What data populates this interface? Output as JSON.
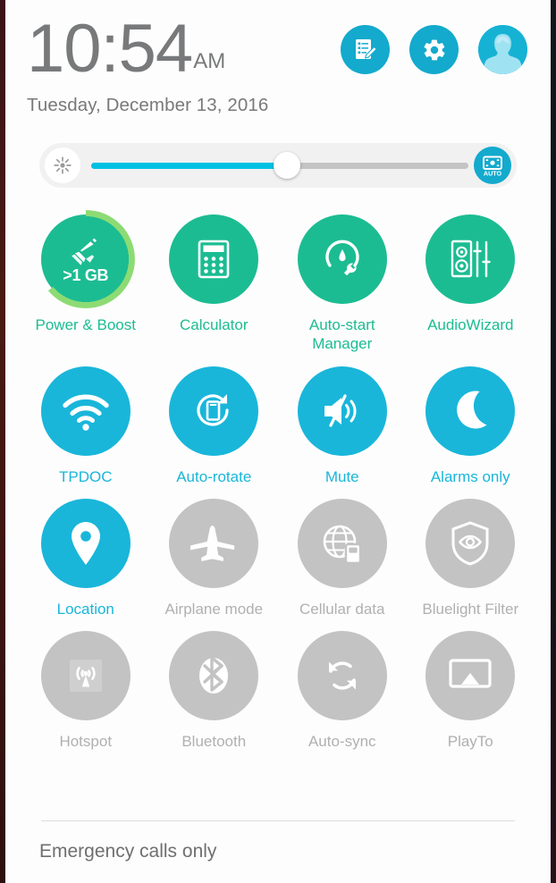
{
  "status_bar": {
    "clock_time": "10:54",
    "clock_ampm": "AM",
    "date": "Tuesday, December 13, 2016"
  },
  "header_actions": [
    {
      "name": "edit-quick-settings-button",
      "icon": "edit-list-icon",
      "label": "Edit quick settings"
    },
    {
      "name": "settings-button",
      "icon": "gear-icon",
      "label": "Settings"
    },
    {
      "name": "user-profile-button",
      "icon": "user-avatar-icon",
      "label": "User profile"
    }
  ],
  "brightness": {
    "icon": "brightness-sun-icon",
    "value_percent": 52,
    "auto_label": "AUTO",
    "auto_icon": "auto-brightness-icon"
  },
  "tiles": [
    {
      "label": "Power & Boost",
      "state": "green",
      "icon": "broom-icon",
      "badge": ">1 GB",
      "ring_percent": 64
    },
    {
      "label": "Calculator",
      "state": "green",
      "icon": "calculator-icon"
    },
    {
      "label": "Auto-start\nManager",
      "state": "green",
      "icon": "gauge-wrench-icon"
    },
    {
      "label": "AudioWizard",
      "state": "green",
      "icon": "audio-equalizer-icon"
    },
    {
      "label": "TPDOC",
      "state": "blue",
      "icon": "wifi-icon"
    },
    {
      "label": "Auto-rotate",
      "state": "blue",
      "icon": "screen-rotate-icon"
    },
    {
      "label": "Mute",
      "state": "blue",
      "icon": "speaker-mute-icon"
    },
    {
      "label": "Alarms only",
      "state": "blue",
      "icon": "crescent-moon-icon"
    },
    {
      "label": "Location",
      "state": "blue",
      "icon": "location-pin-icon"
    },
    {
      "label": "Airplane mode",
      "state": "gray",
      "icon": "airplane-icon"
    },
    {
      "label": "Cellular data",
      "state": "gray",
      "icon": "globe-sim-icon"
    },
    {
      "label": "Bluelight Filter",
      "state": "gray",
      "icon": "shield-eye-icon"
    },
    {
      "label": "Hotspot",
      "state": "gray",
      "icon": "hotspot-tower-icon"
    },
    {
      "label": "Bluetooth",
      "state": "gray",
      "icon": "bluetooth-icon"
    },
    {
      "label": "Auto-sync",
      "state": "gray",
      "icon": "sync-arrows-icon"
    },
    {
      "label": "PlayTo",
      "state": "gray",
      "icon": "cast-screen-icon"
    }
  ],
  "footer": {
    "carrier_status": "Emergency calls only"
  },
  "colors": {
    "accent_blue": "#19b6da",
    "accent_green": "#1cbc92",
    "inactive_gray": "#c3c3c3",
    "ring_light_green": "#8ddb74",
    "slider_fill": "#00c0e4"
  }
}
